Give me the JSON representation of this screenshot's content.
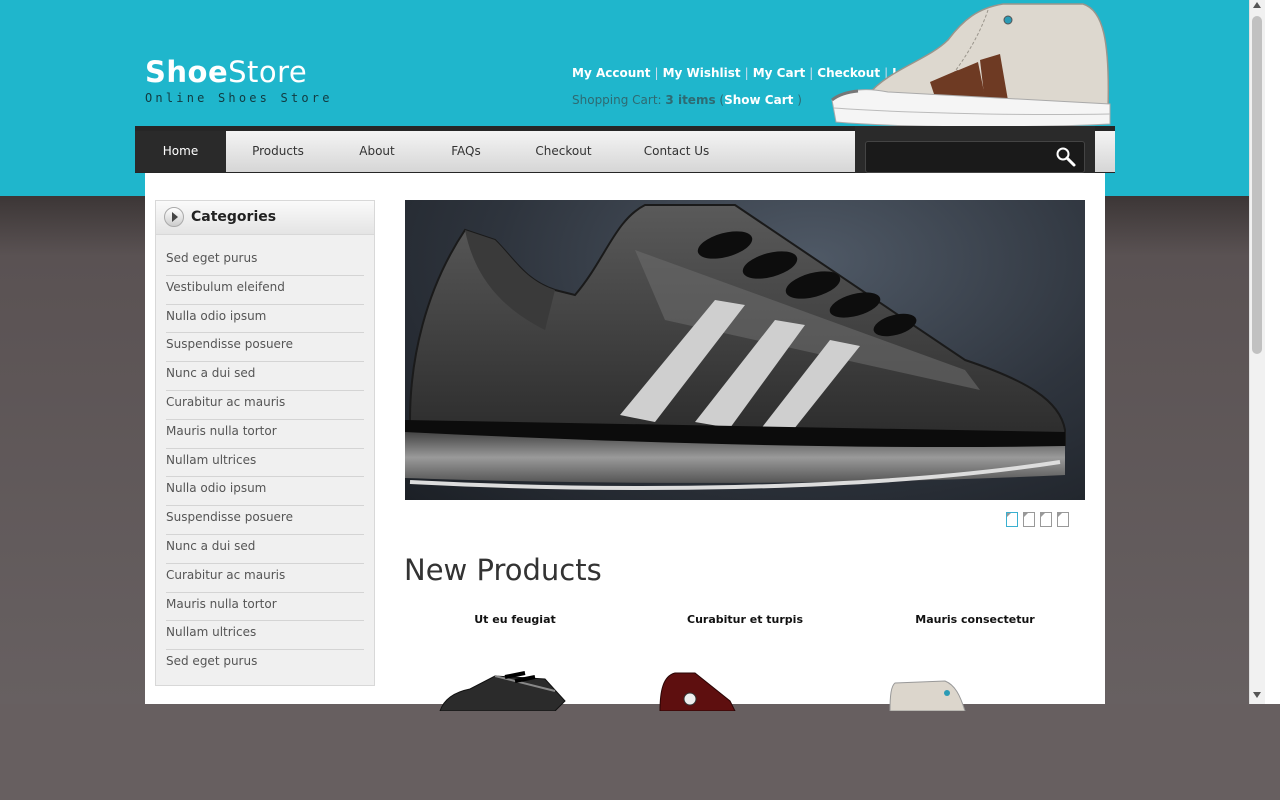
{
  "logo": {
    "bold": "Shoe",
    "light": "Store",
    "tagline": "Online Shoes Store"
  },
  "toplinks": [
    "My Account",
    "My Wishlist",
    "My Cart",
    "Checkout",
    "Log In"
  ],
  "cart": {
    "label": "Shopping Cart:",
    "items": "3 items",
    "open": "(",
    "show": "Show Cart",
    "close": ")"
  },
  "nav": [
    "Home",
    "Products",
    "About",
    "FAQs",
    "Checkout",
    "Contact Us"
  ],
  "nav_active": "Home",
  "search": {
    "value": "",
    "icon": "search-icon"
  },
  "sidebar": {
    "title": "Categories",
    "items": [
      "Sed eget purus",
      "Vestibulum eleifend",
      "Nulla odio ipsum",
      "Suspendisse posuere",
      "Nunc a dui sed",
      "Curabitur ac mauris",
      "Mauris nulla tortor",
      "Nullam ultrices",
      "Nulla odio ipsum",
      "Suspendisse posuere",
      "Nunc a dui sed",
      "Curabitur ac mauris",
      "Mauris nulla tortor",
      "Nullam ultrices",
      "Sed eget purus"
    ]
  },
  "slider": {
    "pages": 4,
    "active": 1
  },
  "new_products": {
    "title": "New Products",
    "items": [
      "Ut eu feugiat",
      "Curabitur et turpis",
      "Mauris consectetur"
    ]
  },
  "colors": {
    "header_teal": "#1fb6cc",
    "background": "#625b5c",
    "nav_active": "#2a2a2a"
  }
}
